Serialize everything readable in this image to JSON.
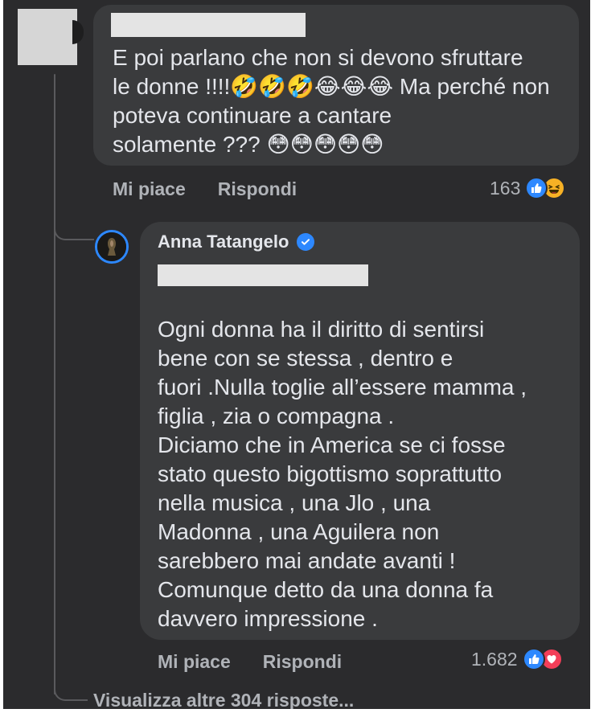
{
  "comments": [
    {
      "text": "E poi parlano che non si devono sfruttare\nle donne !!!!🤣🤣🤣😂😂😂 Ma perché non\npoteva continuare a cantare\nsolamente ??? 😳😳😳😳😳",
      "actions": {
        "like": "Mi piace",
        "reply": "Rispondi"
      },
      "reaction_count": "163",
      "reaction_icons": [
        "like-icon",
        "haha-icon"
      ]
    }
  ],
  "reply": {
    "author": "Anna Tatangelo",
    "verified": true,
    "text": "Ogni donna ha il diritto di sentirsi\nbene con se stessa , dentro e\nfuori .Nulla toglie all’essere mamma ,\nfiglia , zia o compagna .\nDiciamo che in America se ci fosse\nstato questo bigottismo soprattutto\nnella musica , una Jlo , una\nMadonna , una Aguilera non\nsarebbero mai andate avanti !\nComunque detto da una donna fa\ndavvero impressione .",
    "actions": {
      "like": "Mi piace",
      "reply": "Rispondi"
    },
    "reaction_count": "1.682",
    "reaction_icons": [
      "like-icon",
      "love-icon"
    ]
  },
  "more_replies_label": "Visualizza altre 304 risposte...",
  "colors": {
    "background": "#2b2b2d",
    "bubble": "#3a3b3d",
    "text": "#e4e6eb",
    "muted": "#b0b3b8",
    "accent": "#2d88ff"
  }
}
